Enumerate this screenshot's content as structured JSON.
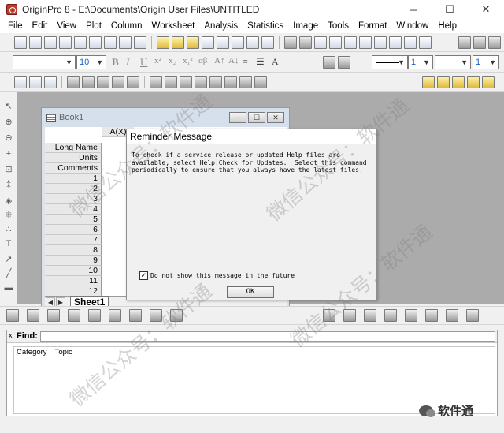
{
  "window": {
    "title": "OriginPro 8 - E:\\Documents\\Origin User Files\\UNTITLED",
    "controls": [
      "─",
      "☐",
      "✕"
    ]
  },
  "menu": [
    "File",
    "Edit",
    "View",
    "Plot",
    "Column",
    "Worksheet",
    "Analysis",
    "Statistics",
    "Image",
    "Tools",
    "Format",
    "Window",
    "Help"
  ],
  "format_toolbar": {
    "font_size": "10",
    "line_width": "1",
    "font_size2": "1"
  },
  "workbook": {
    "title": "Book1",
    "column_header": "A(X)",
    "header_rows": [
      "Long Name",
      "Units",
      "Comments"
    ],
    "row_numbers": [
      "1",
      "2",
      "3",
      "4",
      "5",
      "6",
      "7",
      "8",
      "9",
      "10",
      "11",
      "12"
    ],
    "sheet_tab": "Sheet1"
  },
  "dialog": {
    "title": "Reminder Message",
    "message": "To check if a service release or updated Help files are\navailable, select Help:Check for Updates.  Select this command\nperiodically to ensure that you always have the latest files.",
    "checkbox_label": "Do not show this message in the future",
    "checkbox_checked": true,
    "ok_label": "OK"
  },
  "find_panel": {
    "label": "Find:",
    "close": "x",
    "columns": [
      "Category",
      "Topic"
    ]
  },
  "footer": {
    "label": "软件通"
  },
  "watermark": [
    "微信公众号：软件通",
    "微信公众号：软件通",
    "微信公众号：软件通",
    "微信公众号：软件通"
  ]
}
